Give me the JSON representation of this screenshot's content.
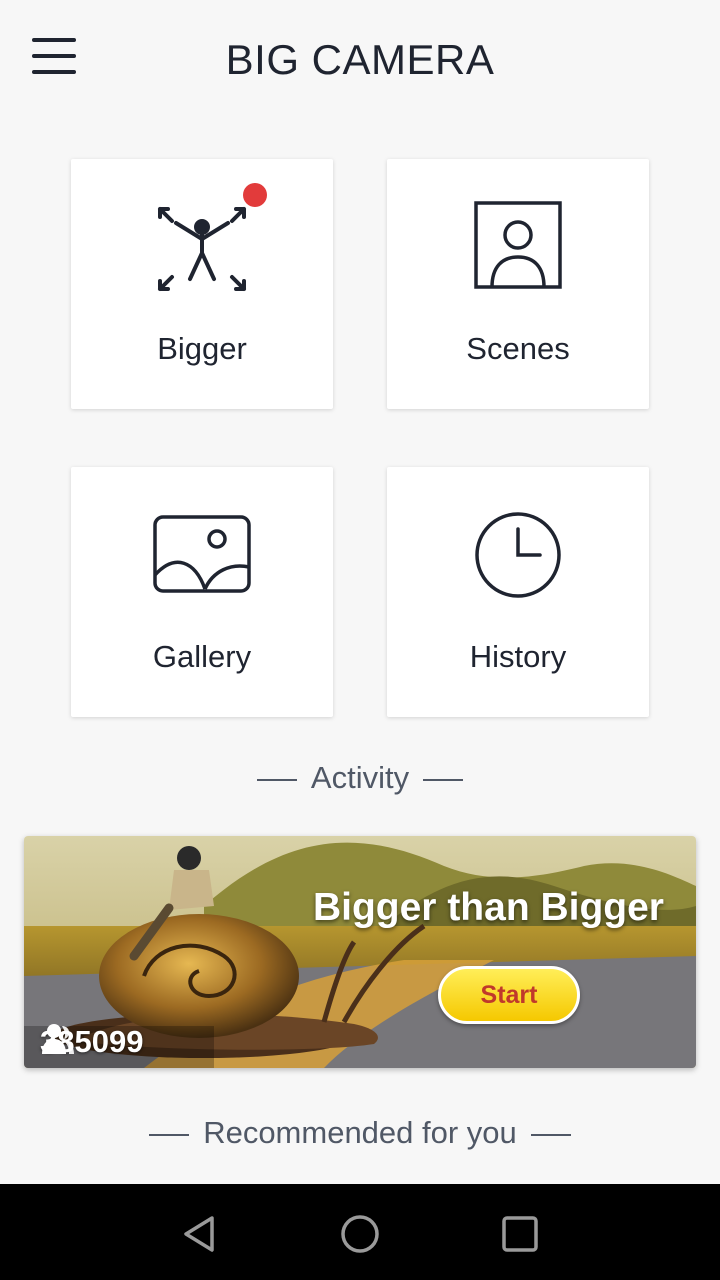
{
  "header": {
    "title": "BIG CAMERA",
    "menu_icon": "hamburger-menu-icon"
  },
  "tiles": [
    {
      "label": "Bigger",
      "icon": "stretch-person-icon",
      "has_badge": true
    },
    {
      "label": "Scenes",
      "icon": "portrait-frame-icon",
      "has_badge": false
    },
    {
      "label": "Gallery",
      "icon": "image-icon",
      "has_badge": false
    },
    {
      "label": "History",
      "icon": "clock-icon",
      "has_badge": false
    }
  ],
  "activity": {
    "section_title": "Activity",
    "banner_title": "Bigger than Bigger",
    "start_label": "Start",
    "participants": "385099",
    "participants_icon": "users-icon"
  },
  "recommended": {
    "section_title": "Recommended for you"
  },
  "navbar": {
    "back_icon": "back-triangle-icon",
    "home_icon": "home-circle-icon",
    "recents_icon": "recents-square-icon"
  },
  "colors": {
    "badge": "#e23b3b",
    "start_button": "#ffe033",
    "start_text": "#c0392b",
    "text_dark": "#1f2430"
  }
}
